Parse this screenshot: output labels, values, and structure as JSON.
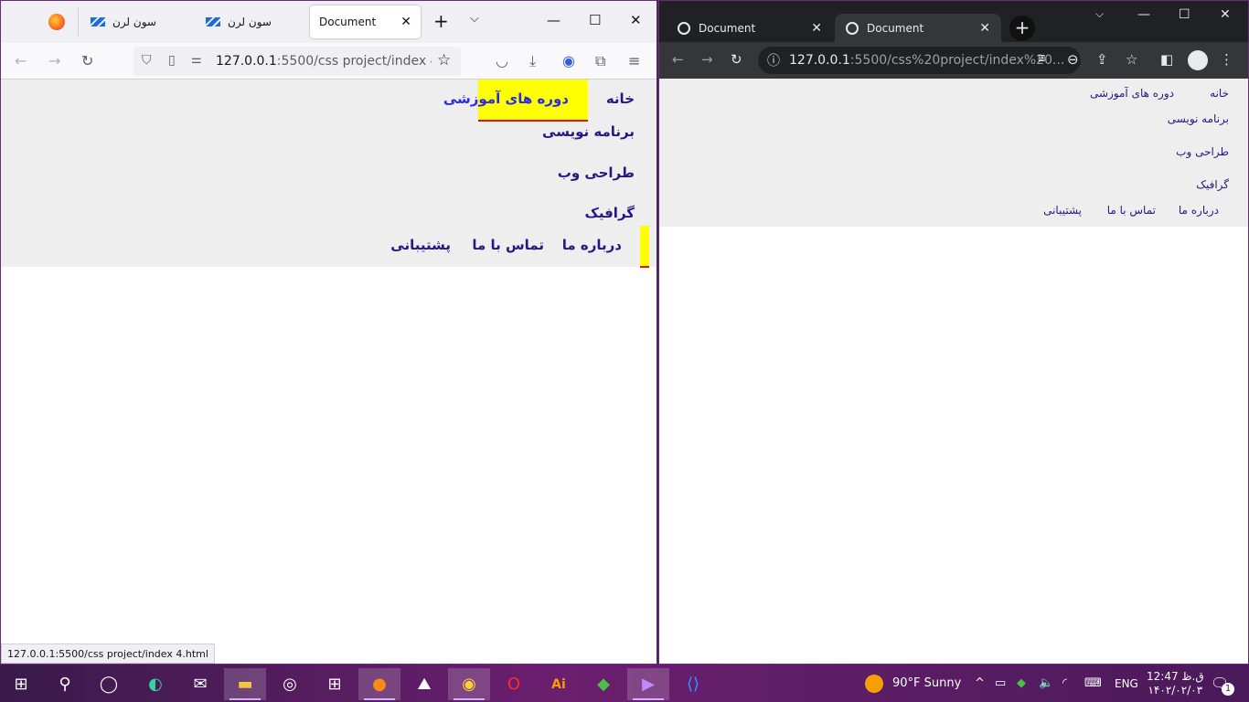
{
  "firefox": {
    "tabs": [
      {
        "label": "سون لرن",
        "icon": "sevenlearn-logo"
      },
      {
        "label": "سون لرن",
        "icon": "sevenlearn-logo"
      },
      {
        "label": "Document",
        "icon": ""
      }
    ],
    "url_host": "127.0.0.1",
    "url_rest": ":5500/css project/index 4.htm",
    "status_url": "127.0.0.1:5500/css project/index 4.html",
    "page": {
      "home": "خانه",
      "courses": "دوره های آموزشی",
      "programming": "برنامه نویسی",
      "webdesign": "طراحی وب",
      "graphic": "گرافیک",
      "about": "درباره ما",
      "contact": "تماس با ما",
      "support": "پشتیبانی"
    },
    "colors": {
      "highlight": "#ffff00",
      "underline": "#e0101f",
      "link": "#2a1784",
      "page_bg": "#eeeeee"
    }
  },
  "chrome": {
    "tabs": [
      {
        "label": "Document",
        "icon": "globe-icon"
      },
      {
        "label": "Document",
        "icon": "globe-icon"
      }
    ],
    "url_host": "127.0.0.1",
    "url_rest": ":5500/css%20project/index%20...",
    "page": {
      "home": "خانه",
      "courses": "دوره های آموزشی",
      "programming": "برنامه نویسی",
      "webdesign": "طراحی وب",
      "graphic": "گرافیک",
      "about": "درباره ما",
      "contact": "تماس با ما",
      "support": "پشتیبانی"
    }
  },
  "taskbar": {
    "weather": "90°F  Sunny",
    "lang": "ENG",
    "time": "12:47 ق.ظ",
    "date": "۱۴۰۲/۰۲/۰۳",
    "notifications": "1"
  }
}
